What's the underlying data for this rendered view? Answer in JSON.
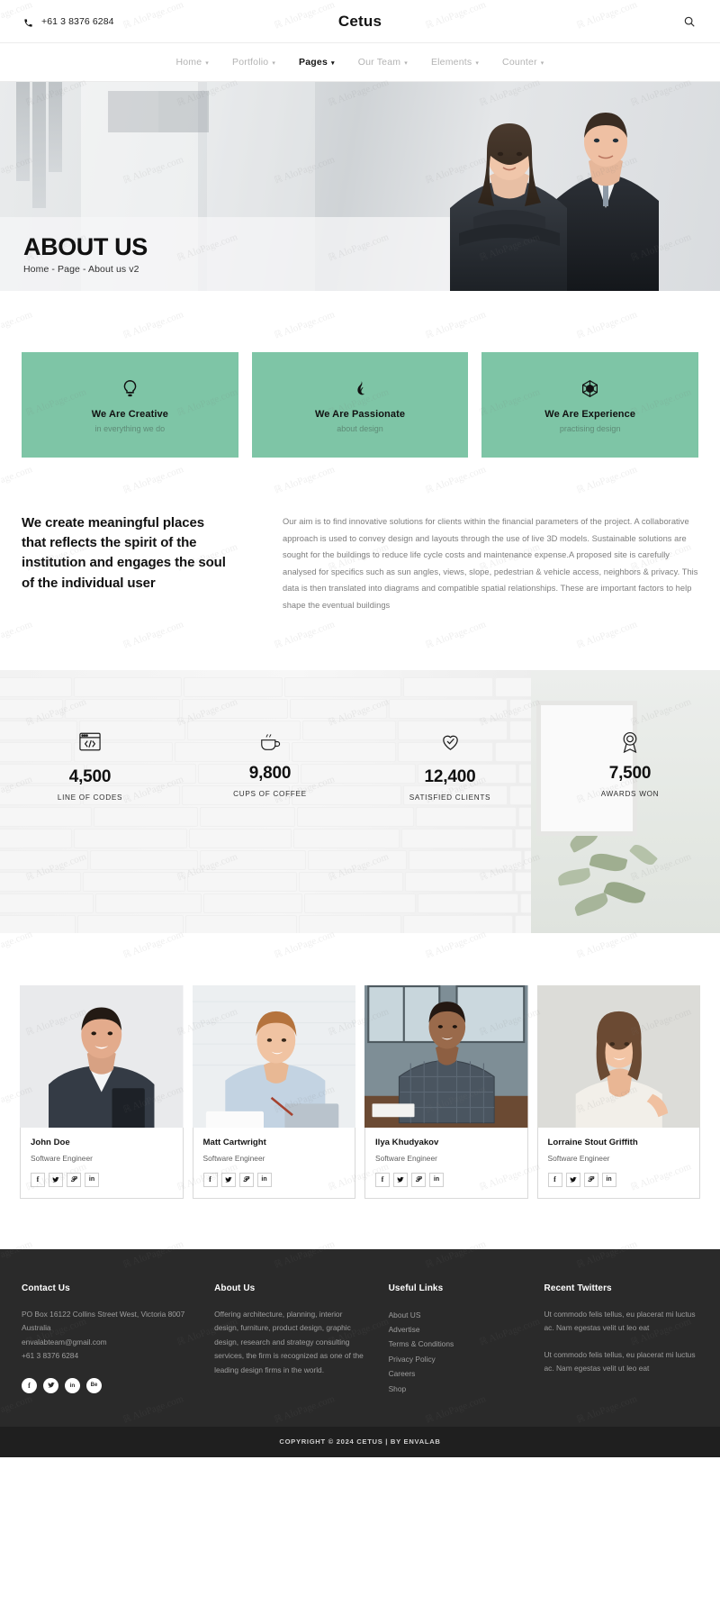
{
  "topbar": {
    "phone": "+61 3 8376 6284",
    "brand": "Cetus",
    "phone_icon": "phone-icon",
    "search_icon": "search-icon"
  },
  "nav": {
    "items": [
      {
        "label": "Home",
        "has_caret": true,
        "active": false
      },
      {
        "label": "Portfolio",
        "has_caret": true,
        "active": false
      },
      {
        "label": "Pages",
        "has_caret": true,
        "active": true
      },
      {
        "label": "Our Team",
        "has_caret": true,
        "active": false
      },
      {
        "label": "Elements",
        "has_caret": true,
        "active": false
      },
      {
        "label": "Counter",
        "has_caret": true,
        "active": false
      }
    ],
    "caret_glyph": "▾"
  },
  "hero": {
    "title": "ABOUT US",
    "breadcrumb": "Home - Page - About us v2"
  },
  "features": {
    "accent_color": "#7ec5a6",
    "cards": [
      {
        "icon": "lightbulb-icon",
        "title": "We Are Creative",
        "subtitle": "in everything we do"
      },
      {
        "icon": "flame-icon",
        "title": "We Are Passionate",
        "subtitle": "about design"
      },
      {
        "icon": "polyhedron-icon",
        "title": "We Are Experience",
        "subtitle": "practising design"
      }
    ]
  },
  "intro": {
    "heading": "We create meaningful places that reflects the spirit of the institution and engages the soul of the individual user",
    "body": "Our aim is to find innovative solutions for clients within the financial parameters of the project. A collaborative approach is used to convey design and layouts through the use of live 3D models. Sustainable solutions are sought for the buildings to reduce life cycle costs and maintenance expense.A proposed site is carefully analysed for specifics such as sun angles, views, slope, pedestrian & vehicle access, neighbors & privacy. This data is then translated into diagrams and compatible spatial relationships. These are important factors to help shape the eventual buildings"
  },
  "counters": {
    "items": [
      {
        "icon": "code-window-icon",
        "value": "4,500",
        "label": "LINE OF CODES"
      },
      {
        "icon": "coffee-cup-icon",
        "value": "9,800",
        "label": "CUPS OF COFFEE"
      },
      {
        "icon": "heart-check-icon",
        "value": "12,400",
        "label": "SATISFIED CLIENTS"
      },
      {
        "icon": "award-badge-icon",
        "value": "7,500",
        "label": "AWARDS WON"
      }
    ]
  },
  "team": {
    "social_icons": [
      "facebook-icon",
      "twitter-icon",
      "pinterest-icon",
      "linkedin-icon"
    ],
    "social_glyphs": [
      "f",
      "✓",
      "℗",
      "in"
    ],
    "members": [
      {
        "name": "John Doe",
        "role": "Software Engineer"
      },
      {
        "name": "Matt Cartwright",
        "role": "Software Engineer"
      },
      {
        "name": "Ilya Khudyakov",
        "role": "Software Engineer"
      },
      {
        "name": "Lorraine Stout Griffith",
        "role": "Software Engineer"
      }
    ]
  },
  "footer": {
    "contact": {
      "title": "Contact Us",
      "address": "PO Box 16122 Collins Street West, Victoria 8007 Australia",
      "email": "envalabteam@gmail.com",
      "phone": "+61 3 8376 6284",
      "socials": [
        "facebook-icon",
        "twitter-icon",
        "linkedin-icon",
        "behance-icon"
      ],
      "social_glyphs": [
        "f",
        "✓",
        "in",
        "Be"
      ]
    },
    "about": {
      "title": "About Us",
      "text": "Offering architecture, planning, interior design, furniture, product design, graphic design, research and strategy consulting services, the firm is recognized as one of the leading design firms in the world."
    },
    "links": {
      "title": "Useful Links",
      "items": [
        "About US",
        "Advertise",
        "Terms & Conditions",
        "Privacy Policy",
        "Careers",
        "Shop"
      ]
    },
    "tweets": {
      "title": "Recent Twitters",
      "items": [
        "Ut commodo felis tellus, eu placerat mi luctus ac. Nam egestas velit ut leo eat",
        "Ut commodo felis tellus, eu placerat mi luctus ac. Nam egestas velit ut leo eat"
      ]
    }
  },
  "copyright": "COPYRIGHT © 2024 CETUS | BY ENVALAB",
  "watermark": "ℝ AloPage.com"
}
